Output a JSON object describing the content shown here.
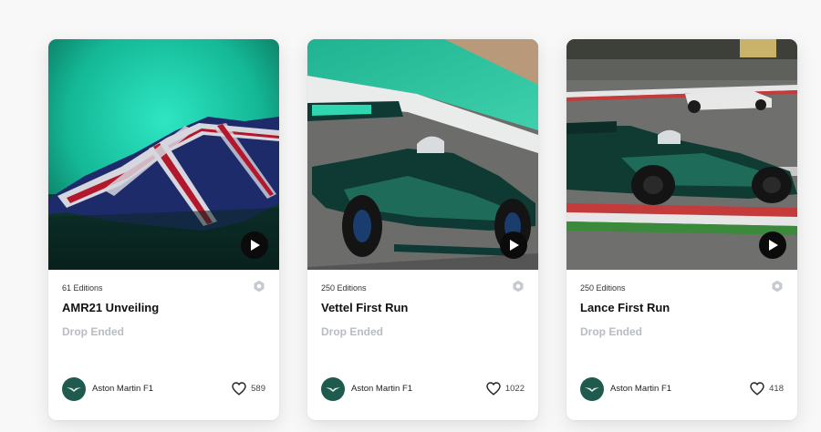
{
  "cards": [
    {
      "editions": "61 Editions",
      "title": "AMR21 Unveiling",
      "status": "Drop Ended",
      "creator": "Aston Martin F1",
      "likes": "589"
    },
    {
      "editions": "250 Editions",
      "title": "Vettel First Run",
      "status": "Drop Ended",
      "creator": "Aston Martin F1",
      "likes": "1022"
    },
    {
      "editions": "250 Editions",
      "title": "Lance First Run",
      "status": "Drop Ended",
      "creator": "Aston Martin F1",
      "likes": "418"
    }
  ],
  "colors": {
    "brand_green": "#1f5a4f",
    "muted_text": "#b8bcc2",
    "teal_backdrop": "#14c9a4"
  },
  "icons": {
    "play": "play-icon",
    "badge": "hexagon-badge-icon",
    "like": "heart-icon",
    "avatar": "aston-martin-wings-icon"
  }
}
